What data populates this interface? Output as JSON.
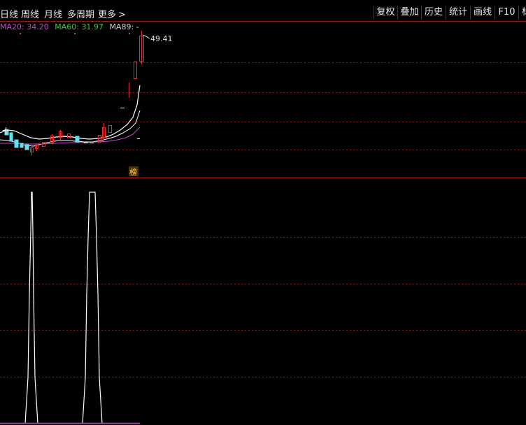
{
  "toolbar": {
    "tabs": [
      "日线",
      "周线",
      "月线",
      "多周期",
      "更多"
    ],
    "tab_more_arrow": ">",
    "buttons": [
      "复权",
      "叠加",
      "历史",
      "统计",
      "画线",
      "F10",
      "标"
    ]
  },
  "legend": {
    "ma20_label": "MA20:",
    "ma20_value": "34.20",
    "ma60_label": "MA60:",
    "ma60_value": "31.97",
    "ma89_label": "MA89:",
    "ma89_value": "-"
  },
  "price_annotation": "49.41",
  "marker_label": "榜",
  "colors": {
    "background": "#000000",
    "grid": "#8b1a1a",
    "candle_up": "#e03030",
    "candle_down": "#60e0f0",
    "ma20": "#d040d0",
    "ma60": "#30d030",
    "ma_white": "#ffffff",
    "indicator": "#ffffff",
    "marker_bg": "#4a3000",
    "marker_fg": "#ffd060"
  }
}
